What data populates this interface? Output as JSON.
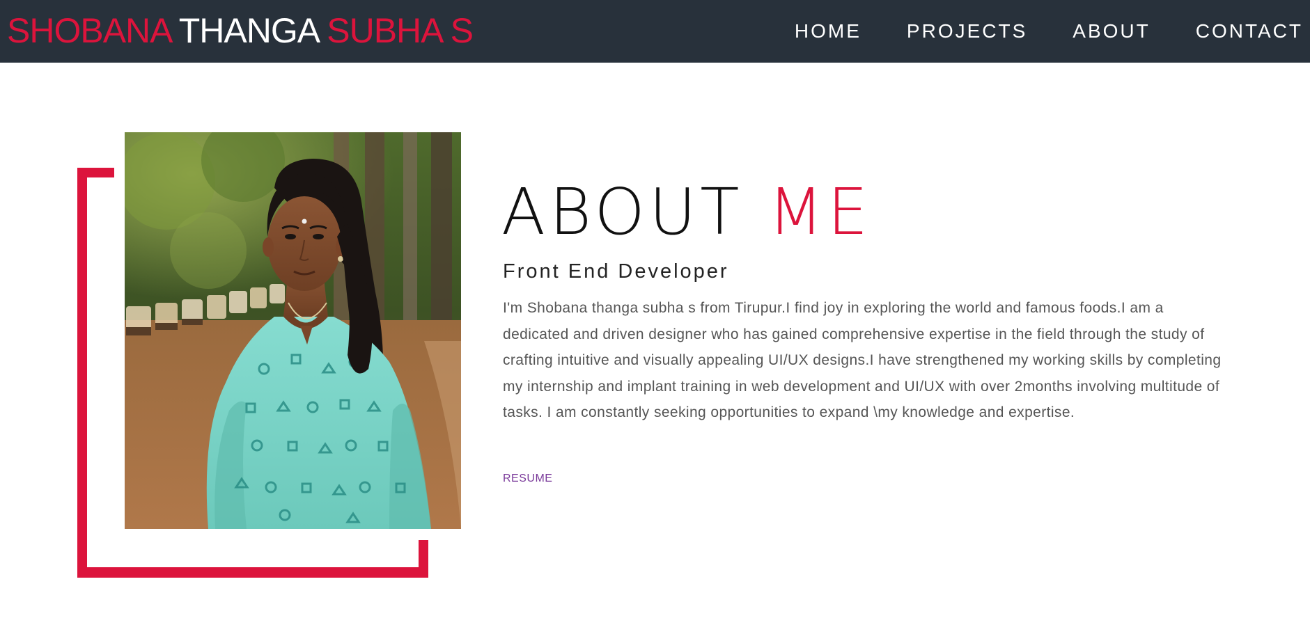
{
  "header": {
    "brand": {
      "first": "SHOBANA",
      "middle": "THANGA",
      "last": "SUBHA S"
    },
    "nav": [
      {
        "label": "HOME"
      },
      {
        "label": "PROJECTS"
      },
      {
        "label": "ABOUT"
      },
      {
        "label": "CONTACT"
      }
    ]
  },
  "about": {
    "title_main": "ABOUT",
    "title_accent": "ME",
    "role": "Front End Developer",
    "bio": "I'm Shobana thanga subha s from Tirupur.I find joy in exploring the world and famous foods.I am a dedicated and driven designer who has gained comprehensive expertise in the field through the study of crafting intuitive and visually appealing UI/UX designs.I have strengthened my working skills by completing my internship and implant training in web development and UI/UX with over 2months involving multitude of tasks. I am constantly seeking opportunities to expand \\my knowledge and expertise.",
    "resume_label": "RESUME"
  },
  "colors": {
    "accent": "#dc143c",
    "navbar_bg": "#28313b",
    "resume_link": "#7a3a9a"
  }
}
